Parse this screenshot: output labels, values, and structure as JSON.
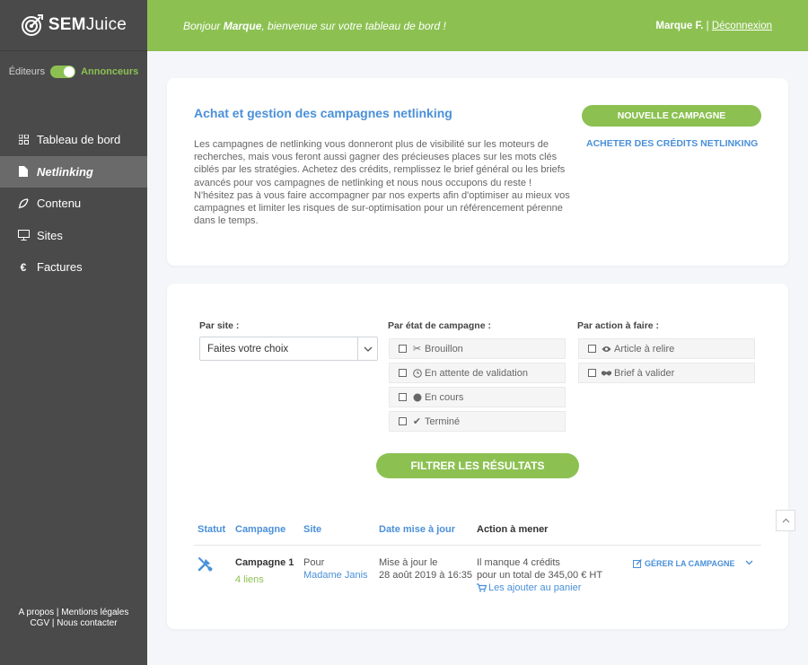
{
  "app": {
    "name_sem": "SEM",
    "name_juice": "Juice"
  },
  "sidebar": {
    "toggle_left": "Éditeurs",
    "toggle_right": "Annonceurs",
    "items": [
      {
        "label": "Tableau de bord",
        "icon": "grid-icon"
      },
      {
        "label": "Netlinking",
        "icon": "document-icon"
      },
      {
        "label": "Contenu",
        "icon": "feather-icon"
      },
      {
        "label": "Sites",
        "icon": "monitor-icon"
      },
      {
        "label": "Factures",
        "icon": "euro-icon"
      }
    ],
    "footer_line1": "A propos | Mentions légales",
    "footer_line2": "CGV | Nous contacter"
  },
  "topbar": {
    "welcome_prefix": "Bonjour ",
    "welcome_name": "Marque",
    "welcome_suffix": ", bienvenue sur votre tableau de bord !",
    "user_name": "Marque F.",
    "logout": "Déconnexion"
  },
  "intro": {
    "title": "Achat et gestion des campagnes netlinking",
    "description": "Les campagnes de netlinking vous donneront plus de visibilité sur les moteurs de recherches, mais vous feront aussi gagner des précieuses places sur les mots clés ciblés par les stratégies. Achetez des crédits, remplissez le brief général ou les briefs avancés pour vos campagnes de netlinking et nous nous occupons du reste ! N'hésitez pas à vous faire accompagner par nos experts afin d'optimiser au mieux vos campagnes et limiter les risques de sur-optimisation pour un référencement pérenne dans le temps.",
    "new_campaign": "NOUVELLE CAMPAGNE",
    "buy_credits": "ACHETER DES CRÉDITS NETLINKING"
  },
  "filters": {
    "site_label": "Par site :",
    "site_value": "Faites votre choix",
    "state_label": "Par état de campagne :",
    "states": [
      "Brouillon",
      "En attente de validation",
      "En cours",
      "Terminé"
    ],
    "action_label": "Par action à faire :",
    "actions": [
      "Article à relire",
      "Brief à valider"
    ],
    "filter_button": "FILTRER LES RÉSULTATS"
  },
  "table": {
    "headers": {
      "status": "Statut",
      "campaign": "Campagne",
      "site": "Site",
      "date": "Date mise à jour",
      "action": "Action à mener"
    },
    "row": {
      "campaign_name": "Campagne 1",
      "links": "4 liens",
      "site_line1": "Pour",
      "site_line2": "Madame Janis",
      "date_line1": "Mise à jour le",
      "date_line2": "28 août 2019 à 16:35",
      "action_line1": "Il manque 4 crédits",
      "action_line2": "pour un total de 345,00 € HT",
      "action_link": "Les ajouter au panier",
      "manage": "GÉRER LA CAMPAGNE"
    }
  },
  "colors": {
    "green": "#8cc152",
    "blue": "#4a90d9",
    "sidebar": "#4a4a4a"
  }
}
